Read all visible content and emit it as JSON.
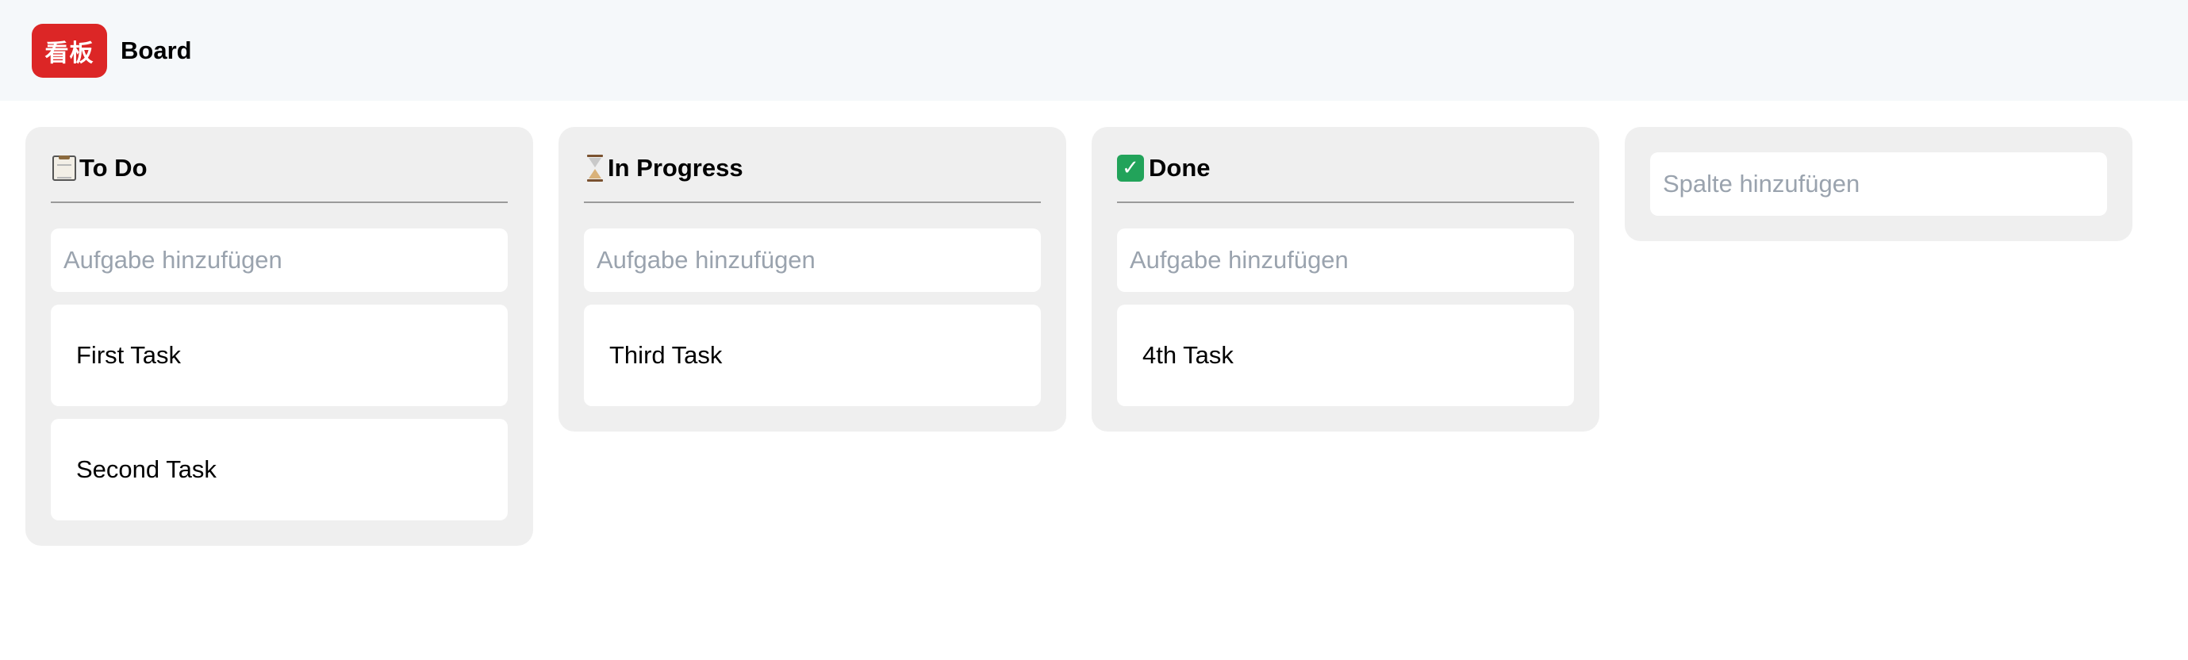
{
  "header": {
    "logo_text": "看板",
    "title": "Board"
  },
  "columns": [
    {
      "icon": "clipboard-icon",
      "title": "To Do",
      "add_placeholder": "Aufgabe hinzufügen",
      "cards": [
        "First Task",
        "Second Task"
      ]
    },
    {
      "icon": "hourglass-icon",
      "title": "In Progress",
      "add_placeholder": "Aufgabe hinzufügen",
      "cards": [
        "Third Task"
      ]
    },
    {
      "icon": "check-mark-icon",
      "title": "Done",
      "add_placeholder": "Aufgabe hinzufügen",
      "cards": [
        "4th Task"
      ]
    }
  ],
  "add_column": {
    "placeholder": "Spalte hinzufügen"
  },
  "colors": {
    "logo_background": "#dc2626",
    "header_background": "#f5f8fa",
    "column_background": "#efefef",
    "done_check": "#22a35a"
  }
}
